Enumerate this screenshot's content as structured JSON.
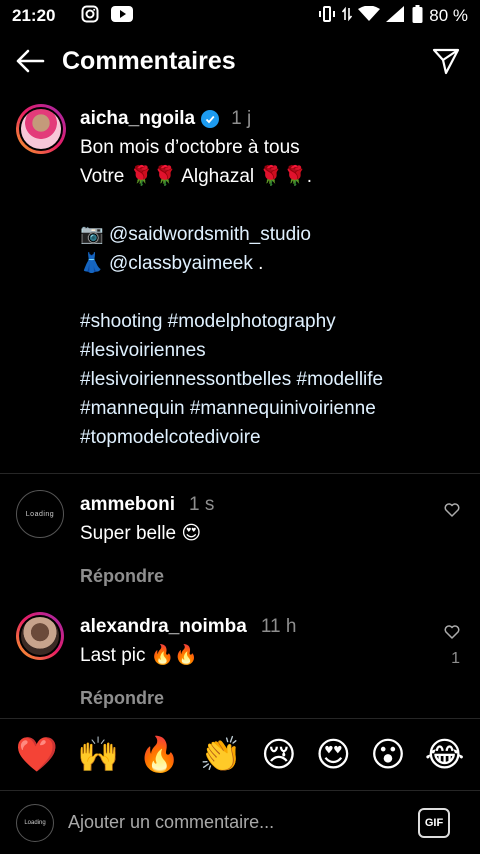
{
  "status_bar": {
    "time": "21:20",
    "battery": "80 %",
    "icons": [
      "instagram-icon",
      "youtube-icon",
      "vibrate-icon",
      "data-icon",
      "wifi-icon",
      "signal-icon",
      "battery-icon"
    ]
  },
  "header": {
    "title": "Commentaires",
    "back_icon": "arrow-left-icon",
    "send_icon": "paper-plane-icon"
  },
  "caption": {
    "username": "aicha_ngoila",
    "verified": true,
    "time": "1 j",
    "line1": "Bon mois d’octobre à tous",
    "line2_a": "Votre ",
    "line2_roses_a": "🌹🌹",
    "line2_b": "Alghazal ",
    "line2_roses_b": "🌹🌹",
    "line2_c": ".",
    "camera_emoji": "📷",
    "mention1": "@saidwordsmith_studio",
    "dress_emoji": "👗",
    "mention2": "@classbyaimeek",
    "mention2_tail": " .",
    "hashtags_line1": "#shooting #modelphotography",
    "hashtags_line2": "#lesivoiriennes",
    "hashtags_line3": "#lesivoiriennessontbelles #modellife",
    "hashtags_line4": "#mannequin #mannequinivoirienne",
    "hashtags_line5": "#topmodelcotedivoire"
  },
  "comments": [
    {
      "username": "ammeboni",
      "time": "1 s",
      "text": "Super belle 😍",
      "reply_label": "Répondre",
      "avatar_text": "Loading"
    },
    {
      "username": "alexandra_noimba",
      "time": "11 h",
      "text": "Last pic 🔥🔥",
      "reply_label": "Répondre",
      "like_count": "1"
    }
  ],
  "emoji_bar": [
    "❤️",
    "🙌",
    "🔥",
    "👏",
    "😢",
    "😍",
    "😮",
    "😂"
  ],
  "input": {
    "placeholder": "Ajouter un commentaire...",
    "gif_label": "GIF",
    "avatar_text": "Loading"
  },
  "colors": {
    "background": "#000000",
    "secondary_text": "#8e8e8e",
    "verified": "#1d9bf0",
    "divider": "#262626"
  }
}
